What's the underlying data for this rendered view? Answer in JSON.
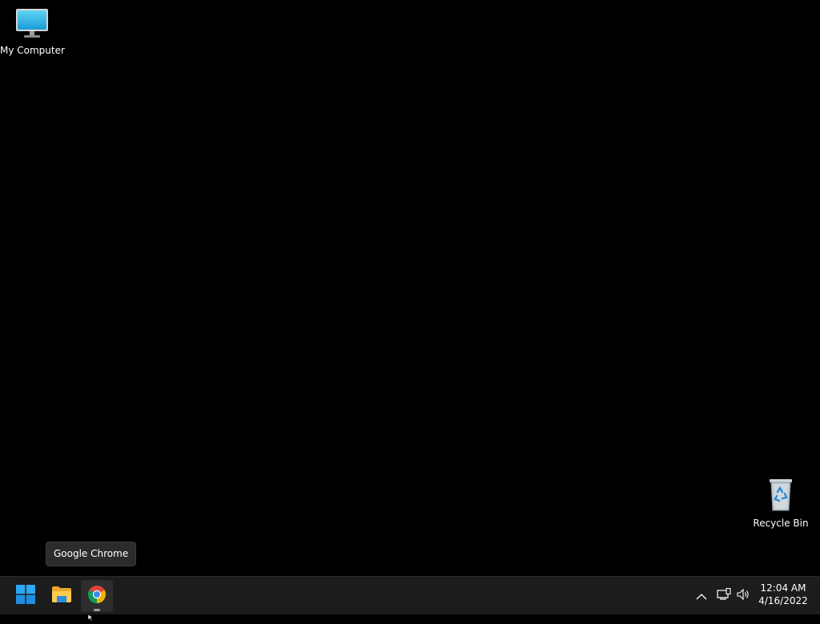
{
  "desktop": {
    "background_color": "#000000",
    "icons": [
      {
        "label": "My Computer",
        "icon": "monitor-icon"
      },
      {
        "label": "Recycle Bin",
        "icon": "recycle-bin-icon"
      }
    ]
  },
  "tooltip": {
    "text": "Google Chrome"
  },
  "taskbar": {
    "background_color": "#1c1c1c",
    "apps": [
      {
        "name": "Start",
        "icon": "windows-logo-icon"
      },
      {
        "name": "File Explorer",
        "icon": "folder-icon"
      },
      {
        "name": "Google Chrome",
        "icon": "chrome-icon",
        "active": true
      }
    ],
    "tray": {
      "icons": [
        "chevron-up-icon",
        "network-icon",
        "volume-icon"
      ]
    },
    "clock": {
      "time": "12:04 AM",
      "date": "4/16/2022"
    }
  }
}
